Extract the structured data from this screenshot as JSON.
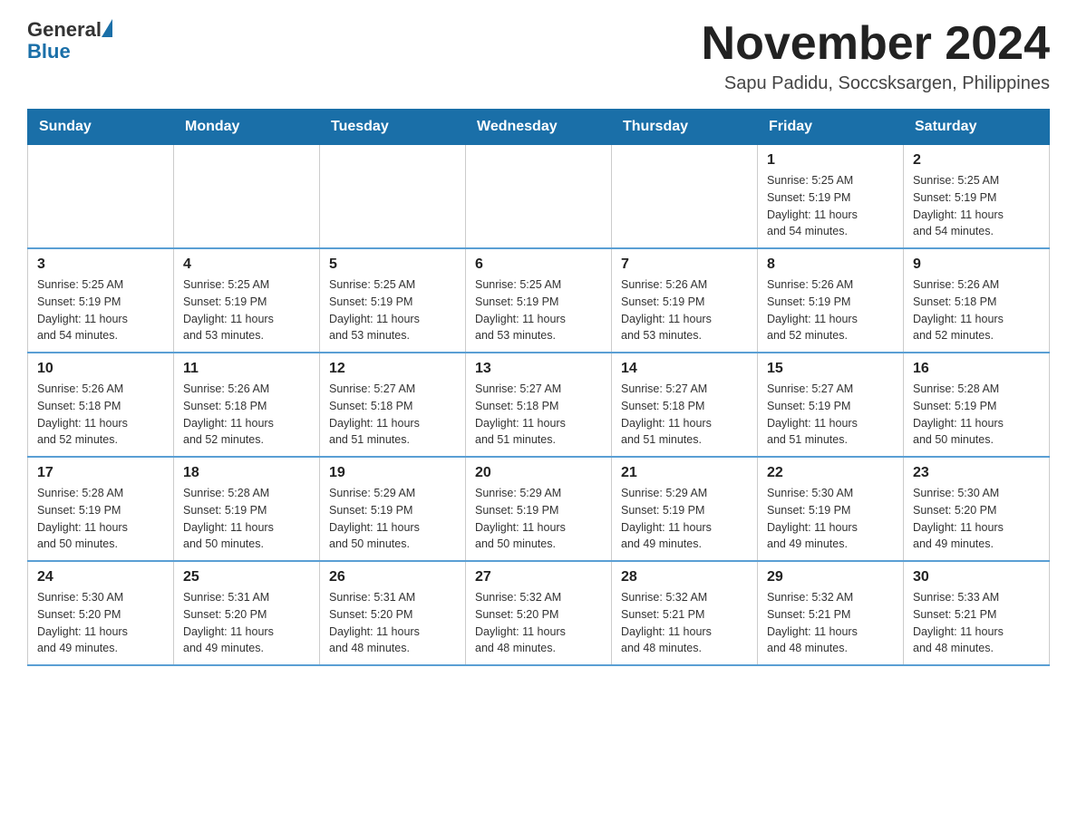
{
  "header": {
    "logo": {
      "general": "General",
      "blue": "Blue"
    },
    "title": "November 2024",
    "location": "Sapu Padidu, Soccsksargen, Philippines"
  },
  "days_of_week": [
    "Sunday",
    "Monday",
    "Tuesday",
    "Wednesday",
    "Thursday",
    "Friday",
    "Saturday"
  ],
  "weeks": [
    [
      {
        "day": "",
        "info": ""
      },
      {
        "day": "",
        "info": ""
      },
      {
        "day": "",
        "info": ""
      },
      {
        "day": "",
        "info": ""
      },
      {
        "day": "",
        "info": ""
      },
      {
        "day": "1",
        "info": "Sunrise: 5:25 AM\nSunset: 5:19 PM\nDaylight: 11 hours\nand 54 minutes."
      },
      {
        "day": "2",
        "info": "Sunrise: 5:25 AM\nSunset: 5:19 PM\nDaylight: 11 hours\nand 54 minutes."
      }
    ],
    [
      {
        "day": "3",
        "info": "Sunrise: 5:25 AM\nSunset: 5:19 PM\nDaylight: 11 hours\nand 54 minutes."
      },
      {
        "day": "4",
        "info": "Sunrise: 5:25 AM\nSunset: 5:19 PM\nDaylight: 11 hours\nand 53 minutes."
      },
      {
        "day": "5",
        "info": "Sunrise: 5:25 AM\nSunset: 5:19 PM\nDaylight: 11 hours\nand 53 minutes."
      },
      {
        "day": "6",
        "info": "Sunrise: 5:25 AM\nSunset: 5:19 PM\nDaylight: 11 hours\nand 53 minutes."
      },
      {
        "day": "7",
        "info": "Sunrise: 5:26 AM\nSunset: 5:19 PM\nDaylight: 11 hours\nand 53 minutes."
      },
      {
        "day": "8",
        "info": "Sunrise: 5:26 AM\nSunset: 5:19 PM\nDaylight: 11 hours\nand 52 minutes."
      },
      {
        "day": "9",
        "info": "Sunrise: 5:26 AM\nSunset: 5:18 PM\nDaylight: 11 hours\nand 52 minutes."
      }
    ],
    [
      {
        "day": "10",
        "info": "Sunrise: 5:26 AM\nSunset: 5:18 PM\nDaylight: 11 hours\nand 52 minutes."
      },
      {
        "day": "11",
        "info": "Sunrise: 5:26 AM\nSunset: 5:18 PM\nDaylight: 11 hours\nand 52 minutes."
      },
      {
        "day": "12",
        "info": "Sunrise: 5:27 AM\nSunset: 5:18 PM\nDaylight: 11 hours\nand 51 minutes."
      },
      {
        "day": "13",
        "info": "Sunrise: 5:27 AM\nSunset: 5:18 PM\nDaylight: 11 hours\nand 51 minutes."
      },
      {
        "day": "14",
        "info": "Sunrise: 5:27 AM\nSunset: 5:18 PM\nDaylight: 11 hours\nand 51 minutes."
      },
      {
        "day": "15",
        "info": "Sunrise: 5:27 AM\nSunset: 5:19 PM\nDaylight: 11 hours\nand 51 minutes."
      },
      {
        "day": "16",
        "info": "Sunrise: 5:28 AM\nSunset: 5:19 PM\nDaylight: 11 hours\nand 50 minutes."
      }
    ],
    [
      {
        "day": "17",
        "info": "Sunrise: 5:28 AM\nSunset: 5:19 PM\nDaylight: 11 hours\nand 50 minutes."
      },
      {
        "day": "18",
        "info": "Sunrise: 5:28 AM\nSunset: 5:19 PM\nDaylight: 11 hours\nand 50 minutes."
      },
      {
        "day": "19",
        "info": "Sunrise: 5:29 AM\nSunset: 5:19 PM\nDaylight: 11 hours\nand 50 minutes."
      },
      {
        "day": "20",
        "info": "Sunrise: 5:29 AM\nSunset: 5:19 PM\nDaylight: 11 hours\nand 50 minutes."
      },
      {
        "day": "21",
        "info": "Sunrise: 5:29 AM\nSunset: 5:19 PM\nDaylight: 11 hours\nand 49 minutes."
      },
      {
        "day": "22",
        "info": "Sunrise: 5:30 AM\nSunset: 5:19 PM\nDaylight: 11 hours\nand 49 minutes."
      },
      {
        "day": "23",
        "info": "Sunrise: 5:30 AM\nSunset: 5:20 PM\nDaylight: 11 hours\nand 49 minutes."
      }
    ],
    [
      {
        "day": "24",
        "info": "Sunrise: 5:30 AM\nSunset: 5:20 PM\nDaylight: 11 hours\nand 49 minutes."
      },
      {
        "day": "25",
        "info": "Sunrise: 5:31 AM\nSunset: 5:20 PM\nDaylight: 11 hours\nand 49 minutes."
      },
      {
        "day": "26",
        "info": "Sunrise: 5:31 AM\nSunset: 5:20 PM\nDaylight: 11 hours\nand 48 minutes."
      },
      {
        "day": "27",
        "info": "Sunrise: 5:32 AM\nSunset: 5:20 PM\nDaylight: 11 hours\nand 48 minutes."
      },
      {
        "day": "28",
        "info": "Sunrise: 5:32 AM\nSunset: 5:21 PM\nDaylight: 11 hours\nand 48 minutes."
      },
      {
        "day": "29",
        "info": "Sunrise: 5:32 AM\nSunset: 5:21 PM\nDaylight: 11 hours\nand 48 minutes."
      },
      {
        "day": "30",
        "info": "Sunrise: 5:33 AM\nSunset: 5:21 PM\nDaylight: 11 hours\nand 48 minutes."
      }
    ]
  ]
}
